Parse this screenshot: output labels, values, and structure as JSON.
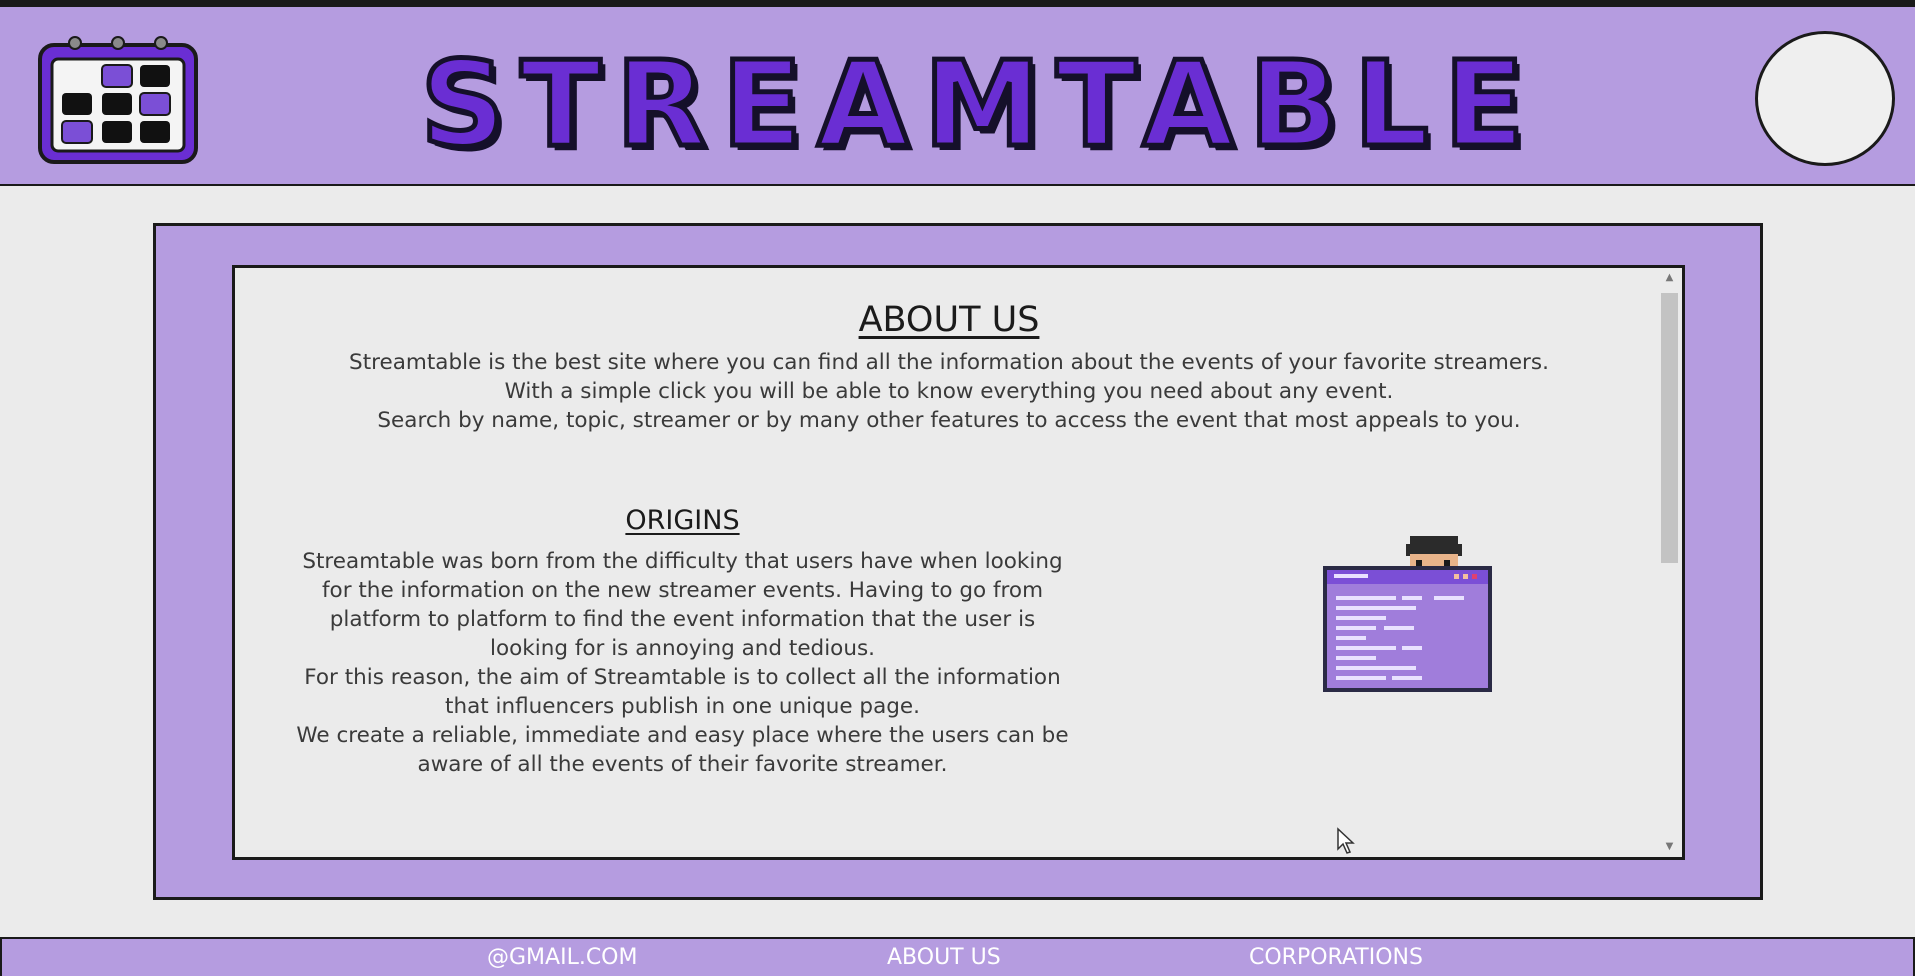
{
  "header": {
    "brand": "STREAMTABLE",
    "logo_icon": "calendar-icon",
    "profile_icon": "avatar-circle"
  },
  "about": {
    "title": "ABOUT US",
    "lines": [
      "Streamtable is the best site where you can find all the information about the events of your favorite streamers.",
      "With a simple click you will be able to know everything you need about any event.",
      "Search by name, topic, streamer or by many other features to access the event that most appeals to you."
    ]
  },
  "origins": {
    "title": "ORIGINS",
    "lines": [
      "Streamtable was born from the difficulty that users have when looking",
      "for the information on the new streamer events. Having to go from",
      "platform to platform to find the event information that the user is",
      "looking for is annoying and tedious.",
      "For this reason, the aim of Streamtable is to collect all the information",
      "that influencers publish in one unique page.",
      "We create a reliable, immediate and easy place where the users can be",
      "aware of all the events of their favorite streamer."
    ],
    "illustration_icon": "person-behind-browser-icon"
  },
  "footer": {
    "email": "@GMAIL.COM",
    "about": "ABOUT US",
    "corporations": "CORPORATIONS"
  },
  "colors": {
    "accent": "#b59ce0",
    "brand_purple": "#6a2ed3",
    "dark": "#1a1a1a",
    "background": "#ebebeb"
  }
}
